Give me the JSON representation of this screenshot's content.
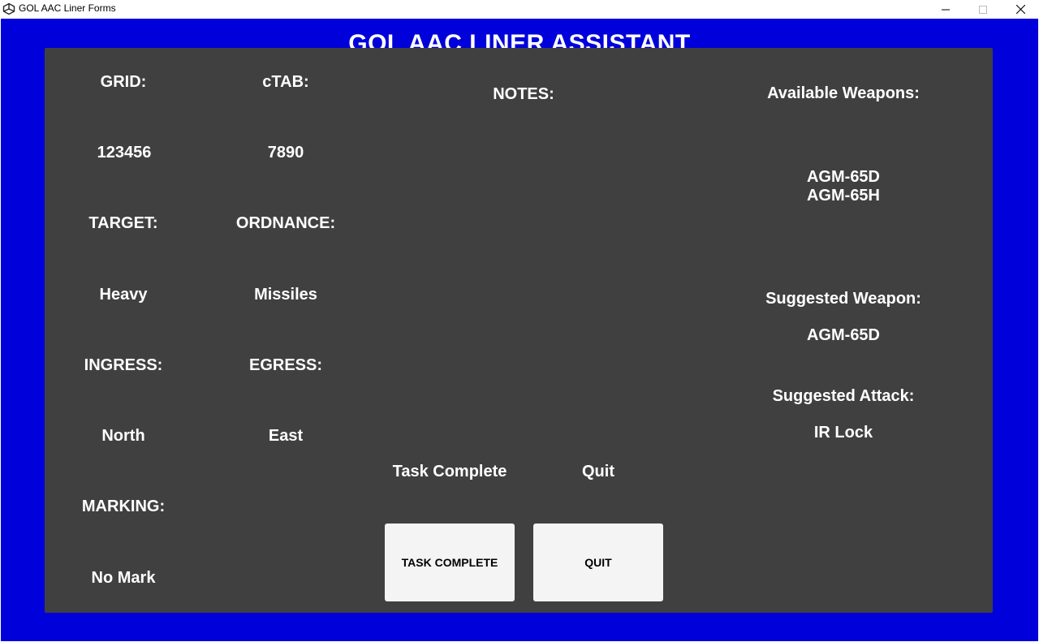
{
  "window": {
    "title": "GOL AAC Liner Forms"
  },
  "app": {
    "heading": "GOL AAC LINER ASSISTANT"
  },
  "form": {
    "grid_label": "GRID:",
    "grid_value": "123456",
    "ctab_label": "cTAB:",
    "ctab_value": "7890",
    "target_label": "TARGET:",
    "target_value": "Heavy",
    "ordnance_label": "ORDNANCE:",
    "ordnance_value": "Missiles",
    "ingress_label": "INGRESS:",
    "ingress_value": "North",
    "egress_label": "EGRESS:",
    "egress_value": "East",
    "marking_label": "MARKING:",
    "marking_value": "No Mark",
    "notes_label": "NOTES:"
  },
  "actions": {
    "task_complete_caption": "Task Complete",
    "quit_caption": "Quit",
    "task_complete_button": "TASK COMPLETE",
    "quit_button": "QUIT"
  },
  "weapons": {
    "available_label": "Available Weapons:",
    "available_list": "AGM-65D\nAGM-65H",
    "suggested_weapon_label": "Suggested Weapon:",
    "suggested_weapon_value": "AGM-65D",
    "suggested_attack_label": "Suggested Attack:",
    "suggested_attack_value": "IR Lock"
  },
  "colors": {
    "background": "#0000db",
    "panel": "#404040",
    "text": "#ffffff",
    "button": "#f4f4f4"
  },
  "icons": {
    "app": "unity-logo-icon",
    "minimize": "minimize-icon",
    "maximize": "maximize-icon",
    "close": "close-icon"
  }
}
